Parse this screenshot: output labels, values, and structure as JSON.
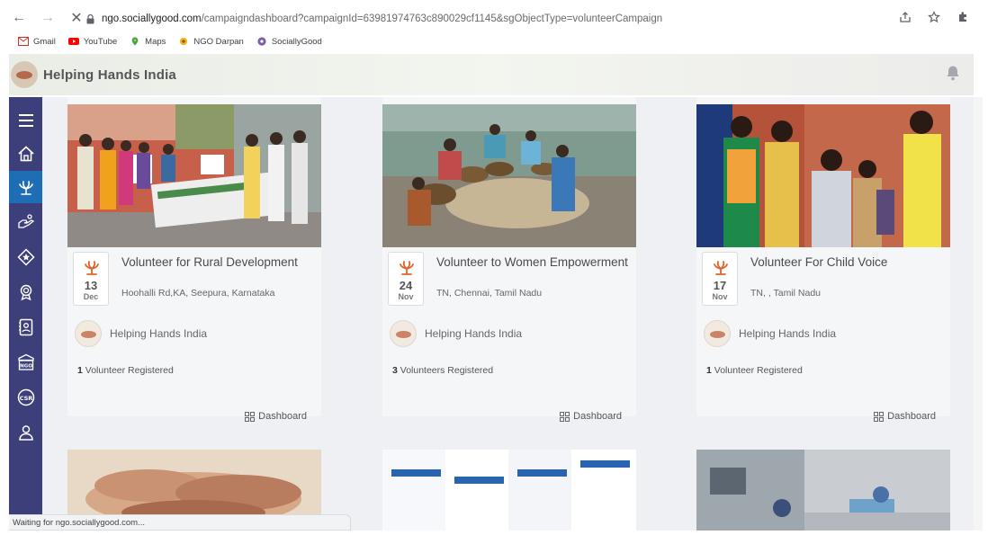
{
  "browser": {
    "url_host": "ngo.sociallygood.com",
    "url_path": "/campaigndashboard?campaignId=63981974763c890029cf1145&sgObjectType=volunteerCampaign",
    "bookmarks": [
      {
        "label": "Gmail",
        "icon": "gmail-icon"
      },
      {
        "label": "YouTube",
        "icon": "youtube-icon"
      },
      {
        "label": "Maps",
        "icon": "maps-icon"
      },
      {
        "label": "NGO Darpan",
        "icon": "ngo-darpan-icon"
      },
      {
        "label": "SociallyGood",
        "icon": "sociallygood-icon"
      }
    ],
    "status_text": "Waiting for ngo.sociallygood.com..."
  },
  "app": {
    "title": "Helping Hands India"
  },
  "sidebar": {
    "items": [
      {
        "name": "menu-icon"
      },
      {
        "name": "home-icon"
      },
      {
        "name": "helping-hands-icon",
        "active": true
      },
      {
        "name": "donate-icon"
      },
      {
        "name": "badge-icon"
      },
      {
        "name": "award-icon"
      },
      {
        "name": "contacts-icon"
      },
      {
        "name": "ngo-icon",
        "text": "NGO"
      },
      {
        "name": "csr-icon",
        "text": "CSR"
      },
      {
        "name": "users-icon"
      }
    ]
  },
  "campaigns": [
    {
      "title": "Volunteer for Rural Development",
      "day": "13",
      "month": "Dec",
      "location": "Hoohalli Rd,KA, Seepura, Karnataka",
      "org": "Helping Hands India",
      "reg_count": "1",
      "reg_label": "Volunteer Registered",
      "dashboard_label": "Dashboard"
    },
    {
      "title": "Volunteer to Women Empowerment",
      "day": "24",
      "month": "Nov",
      "location": "TN, Chennai, Tamil Nadu",
      "org": "Helping Hands India",
      "reg_count": "3",
      "reg_label": "Volunteers Registered",
      "dashboard_label": "Dashboard"
    },
    {
      "title": "Volunteer For Child Voice",
      "day": "17",
      "month": "Nov",
      "location": "TN, , Tamil Nadu",
      "org": "Helping Hands India",
      "reg_count": "1",
      "reg_label": "Volunteer Registered",
      "dashboard_label": "Dashboard"
    }
  ],
  "colors": {
    "sidebar_bg": "#3d3f7a",
    "sidebar_active": "#1f6db5",
    "accent_flame": "#e2632a"
  }
}
